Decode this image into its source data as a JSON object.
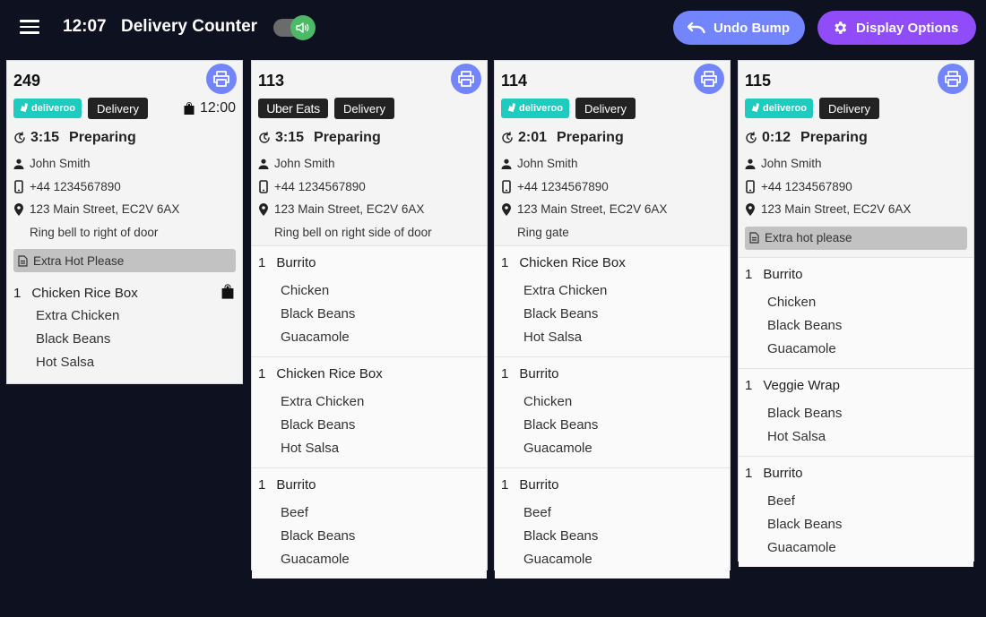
{
  "header": {
    "clock": "12:07",
    "title": "Delivery Counter",
    "sound_toggle_on": true,
    "undo_label": "Undo Bump",
    "display_label": "Display Options"
  },
  "colors": {
    "background": "#0e1120",
    "undo": "#7285fd",
    "display": "#8f4cf8",
    "deliveroo": "#1ecbbf",
    "toggle_on": "#4cb966"
  },
  "orders": [
    {
      "number": "249",
      "platform": "deliveroo",
      "platform_label": "deliveroo",
      "type": "Delivery",
      "pickup_time": "12:00",
      "timer": "3:15",
      "status": "Preparing",
      "customer": "John Smith",
      "phone": "+44 1234567890",
      "address": "123 Main Street, EC2V 6AX",
      "delivery_note": "Ring bell to right of door",
      "order_note": "Extra Hot Please",
      "items": [
        {
          "qty": "1",
          "name": "Chicken Rice Box",
          "mods": [
            "Extra Chicken",
            "Black Beans",
            "Hot Salsa"
          ],
          "bag": true
        }
      ]
    },
    {
      "number": "113",
      "platform": "ubereats",
      "platform_label": "Uber Eats",
      "type": "Delivery",
      "timer": "3:15",
      "status": "Preparing",
      "customer": "John Smith",
      "phone": "+44 1234567890",
      "address": "123 Main Street, EC2V 6AX",
      "delivery_note": "Ring bell on right side of door",
      "items": [
        {
          "qty": "1",
          "name": "Burrito",
          "mods": [
            "Chicken",
            "Black Beans",
            "Guacamole"
          ]
        },
        {
          "qty": "1",
          "name": "Chicken Rice Box",
          "mods": [
            "Extra Chicken",
            "Black Beans",
            "Hot Salsa"
          ]
        },
        {
          "qty": "1",
          "name": "Burrito",
          "mods": [
            "Beef",
            "Black Beans",
            "Guacamole"
          ]
        }
      ]
    },
    {
      "number": "114",
      "platform": "deliveroo",
      "platform_label": "deliveroo",
      "type": "Delivery",
      "timer": "2:01",
      "status": "Preparing",
      "customer": "John Smith",
      "phone": "+44 1234567890",
      "address": "123 Main Street, EC2V 6AX",
      "delivery_note": "Ring gate",
      "items": [
        {
          "qty": "1",
          "name": "Chicken Rice Box",
          "mods": [
            "Extra Chicken",
            "Black Beans",
            "Hot Salsa"
          ]
        },
        {
          "qty": "1",
          "name": "Burrito",
          "mods": [
            "Chicken",
            "Black Beans",
            "Guacamole"
          ]
        },
        {
          "qty": "1",
          "name": "Burrito",
          "mods": [
            "Beef",
            "Black Beans",
            "Guacamole"
          ]
        }
      ]
    },
    {
      "number": "115",
      "platform": "deliveroo",
      "platform_label": "deliveroo",
      "type": "Delivery",
      "timer": "0:12",
      "status": "Preparing",
      "customer": "John Smith",
      "phone": "+44 1234567890",
      "address": "123 Main Street, EC2V 6AX",
      "order_note": "Extra hot please",
      "items": [
        {
          "qty": "1",
          "name": "Burrito",
          "mods": [
            "Chicken",
            "Black Beans",
            "Guacamole"
          ]
        },
        {
          "qty": "1",
          "name": "Veggie Wrap",
          "mods": [
            "Black Beans",
            "Hot Salsa"
          ]
        },
        {
          "qty": "1",
          "name": "Burrito",
          "mods": [
            "Beef",
            "Black Beans",
            "Guacamole"
          ]
        }
      ]
    }
  ]
}
